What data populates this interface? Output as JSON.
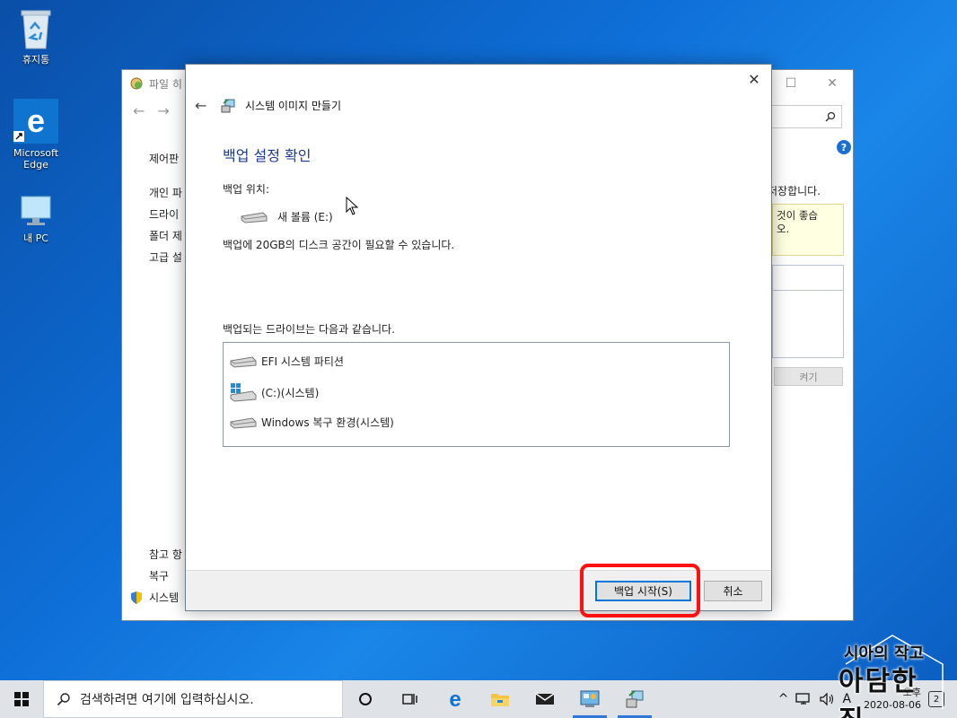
{
  "desktop": {
    "icons": [
      {
        "label": "휴지통"
      },
      {
        "label": "Microsoft Edge"
      },
      {
        "label": "내 PC"
      }
    ]
  },
  "bg_window": {
    "title": "파일 히",
    "side_links": [
      "제어판",
      "개인 파",
      "드라이",
      "폴더 제",
      "고급 설"
    ],
    "related_header": "참고 항",
    "related_links": [
      "복구",
      "시스템"
    ],
    "right_text": "저장합니다.",
    "info_text": "것이 좋습\n오.",
    "button": "켜기"
  },
  "dialog": {
    "title": "시스템 이미지 만들기",
    "heading": "백업 설정 확인",
    "location_label": "백업 위치:",
    "location_value": "새 볼륨 (E:)",
    "space_note": "백업에 20GB의 디스크 공간이 필요할 수 있습니다.",
    "drives_label": "백업되는 드라이브는 다음과 같습니다.",
    "drives": [
      {
        "label": "EFI 시스템 파티션",
        "icon": "drive-icon"
      },
      {
        "label": "(C:)(시스템)",
        "icon": "windows-drive-icon"
      },
      {
        "label": "Windows 복구 환경(시스템)",
        "icon": "drive-icon"
      }
    ],
    "start_button": "백업 시작(S)",
    "cancel_button": "취소"
  },
  "taskbar": {
    "search_placeholder": "검색하려면 여기에 입력하십시오.",
    "ime": "A",
    "time": "오후",
    "date": "2020-08-06",
    "notification_count": "2"
  },
  "watermark": {
    "line1": "시아의 작고",
    "line2": "아담한 집"
  },
  "colors": {
    "accent": "#0078d7",
    "heading": "#1e3a8a",
    "highlight": "#ff1010"
  }
}
